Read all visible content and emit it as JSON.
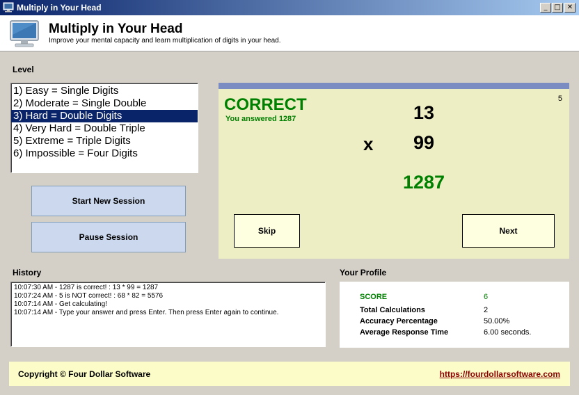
{
  "window": {
    "title": "Multiply in Your Head",
    "minimize": "_",
    "maximize": "□",
    "close": "✕"
  },
  "header": {
    "title": "Multiply in Your Head",
    "subtitle": "Improve your mental capacity and learn multiplication of digits in your head."
  },
  "level": {
    "label": "Level",
    "items": [
      "1) Easy = Single Digits",
      "2) Moderate = Single Double",
      "3) Hard = Double Digits",
      "4) Very Hard = Double Triple",
      "5) Extreme = Triple Digits",
      "6) Impossible = Four Digits"
    ],
    "selected_index": 2
  },
  "buttons": {
    "start": "Start New Session",
    "pause": "Pause Session"
  },
  "quiz": {
    "status": "CORRECT",
    "detail": "You answered 1287",
    "counter": "5",
    "operand_a": "13",
    "operator": "x",
    "operand_b": "99",
    "answer": "1287",
    "skip": "Skip",
    "next": "Next"
  },
  "history": {
    "label": "History",
    "lines": [
      "10:07:30 AM - 1287 is correct! : 13 * 99 = 1287",
      "10:07:24 AM - 5 is NOT correct! : 68 * 82 = 5576",
      "10:07:14 AM - Get calculating!",
      "10:07:14 AM - Type your answer and press Enter. Then press Enter again to continue."
    ]
  },
  "profile": {
    "label": "Your Profile",
    "score_label": "SCORE",
    "score": "6",
    "total_label": "Total Calculations",
    "total": "2",
    "accuracy_label": "Accuracy Percentage",
    "accuracy": "50.00%",
    "response_label": "Average Response Time",
    "response": "6.00 seconds."
  },
  "footer": {
    "copyright": "Copyright © Four Dollar Software",
    "link": "https://fourdollarsoftware.com"
  },
  "colors": {
    "correct": "#008000",
    "selection": "#0a246a",
    "quiz_bg": "#eeeec4",
    "footer_bg": "#fcfcc8",
    "link": "#8b0000"
  }
}
